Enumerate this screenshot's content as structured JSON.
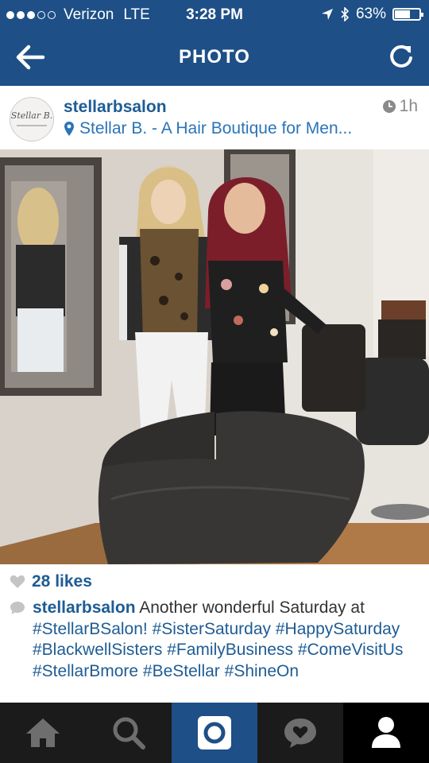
{
  "status_bar": {
    "carrier": "Verizon",
    "network": "LTE",
    "time": "3:28 PM",
    "battery": "63%",
    "battery_level": 0.63
  },
  "nav": {
    "title": "PHOTO"
  },
  "post": {
    "avatar_text": "Stellar B.",
    "username": "stellarbsalon",
    "location": "Stellar B. - A Hair Boutique for Men...",
    "time_ago": "1h"
  },
  "likes": "28 likes",
  "caption": {
    "username": "stellarbsalon",
    "text": "Another wonderful Saturday at",
    "hashtags": [
      "#StellarBSalon!",
      "#SisterSaturday",
      "#HappySaturday",
      "#BlackwellSisters",
      "#FamilyBusiness",
      "#ComeVisitUs",
      "#StellarBmore",
      "#BeStellar",
      "#ShineOn"
    ]
  },
  "tabs": [
    "home",
    "search",
    "camera",
    "activity",
    "profile"
  ],
  "colors": {
    "header": "#1e4f86",
    "link": "#1e5c94",
    "tabbar": "#1b1b1b"
  }
}
